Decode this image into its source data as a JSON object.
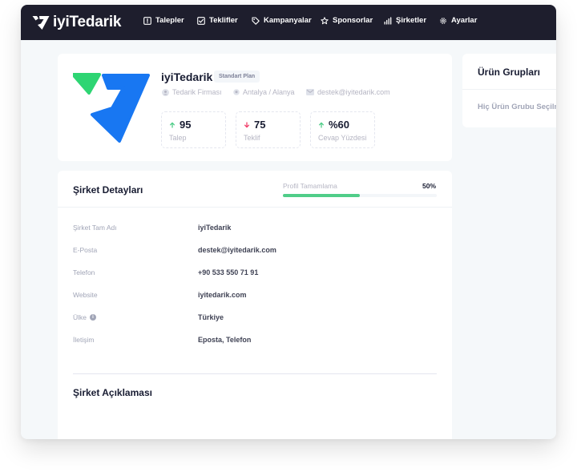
{
  "brand": {
    "name": "iyiTedarik"
  },
  "nav": {
    "items": [
      {
        "label": "Talepler",
        "icon": "request-icon"
      },
      {
        "label": "Teklifler",
        "icon": "offer-icon"
      },
      {
        "label": "Kampanyalar",
        "icon": "tag-icon"
      },
      {
        "label": "Sponsorlar",
        "icon": "star-icon"
      },
      {
        "label": "Şirketler",
        "icon": "chart-bar-icon"
      },
      {
        "label": "Ayarlar",
        "icon": "gear-icon"
      }
    ]
  },
  "profile": {
    "name": "iyiTedarik",
    "plan": "Standart Plan",
    "company_type": "Tedarik Firması",
    "location": "Antalya / Alanya",
    "email": "destek@iyitedarik.com",
    "stats": [
      {
        "value": "95",
        "label": "Talep",
        "trend": "up"
      },
      {
        "value": "75",
        "label": "Teklif",
        "trend": "down"
      },
      {
        "value": "%60",
        "label": "Cevap Yüzdesi",
        "trend": "up"
      }
    ]
  },
  "details": {
    "title": "Şirket Detayları",
    "progress_label": "Profil Tamamlama",
    "progress_text": "50%",
    "progress_value": 0.5,
    "rows": [
      {
        "label": "Şirket Tam Adı",
        "value": "iyiTedarik"
      },
      {
        "label": "E-Posta",
        "value": "destek@iyitedarik.com"
      },
      {
        "label": "Telefon",
        "value": "+90 533 550 71 91"
      },
      {
        "label": "Website",
        "value": "iyitedarik.com"
      },
      {
        "label": "Ülke",
        "value": "Türkiye"
      },
      {
        "label": "İletişim",
        "value": "Eposta, Telefon"
      }
    ],
    "description_title": "Şirket Açıklaması"
  },
  "groups": {
    "title": "Ürün Grupları",
    "empty_text": "Hiç Ürün Grubu Seçilmedi"
  },
  "colors": {
    "nav_bg": "#1e1e2d",
    "accent_green": "#50cd89",
    "accent_red": "#f1416c",
    "brand_blue": "#1877f2",
    "brand_green": "#2ed573"
  }
}
